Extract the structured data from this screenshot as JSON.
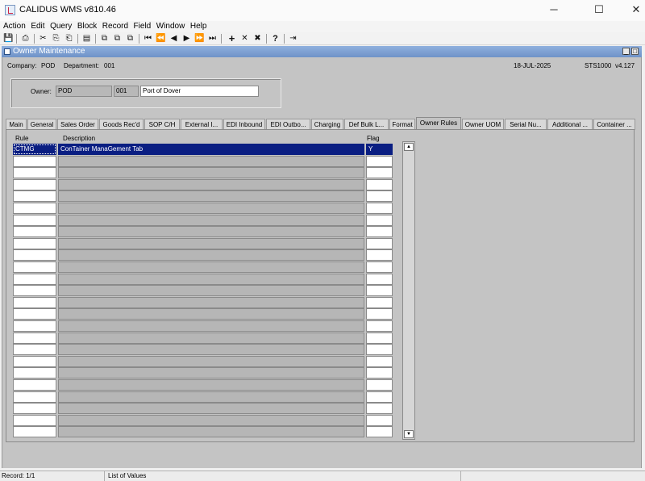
{
  "window": {
    "title": "CALIDUS WMS v810.46",
    "min_glyph": "─",
    "max_glyph": "☐",
    "close_glyph": "✕"
  },
  "menu": [
    "Action",
    "Edit",
    "Query",
    "Block",
    "Record",
    "Field",
    "Window",
    "Help"
  ],
  "toolbar_icons": {
    "save": "save-icon",
    "print": "print-icon",
    "cut": "cut-icon",
    "copy": "copy-icon",
    "paste": "paste-icon",
    "clear": "clear-icon",
    "first": "first-record-icon",
    "prev_block": "previous-block-icon",
    "prev": "previous-record-icon",
    "next": "next-record-icon",
    "next_block": "next-block-icon",
    "last": "last-record-icon",
    "insert": "insert-record-icon",
    "delete": "delete-record-icon",
    "help": "help-icon",
    "exit": "exit-icon"
  },
  "form": {
    "title": "Owner Maintenance"
  },
  "info": {
    "company": "Company:",
    "company_value": "POD",
    "department": "Department:",
    "department_value": "001",
    "date": "18-JUL-2025",
    "module": "STS1000",
    "version": "v4.127"
  },
  "owner": {
    "label": "Owner:",
    "code": "POD",
    "dept": "001",
    "name": "Port of Dover"
  },
  "tabs": [
    "Main",
    "General",
    "Sales Order",
    "Goods Rec'd",
    "SOP C/H",
    "External I...",
    "EDI Inbound",
    "EDI Outbo...",
    "Charging",
    "Def Bulk L...",
    "Format",
    "Owner Rules",
    "Owner UOM",
    "Serial Nu...",
    "Additional ...",
    "Container ..."
  ],
  "active_tab": "Owner Rules",
  "grid": {
    "headers": {
      "rule": "Rule",
      "description": "Description",
      "flag": "Flag"
    },
    "rows": [
      {
        "rule": "CTMG",
        "description": "ConTainer ManaGement Tab",
        "flag": "Y"
      }
    ],
    "visible_rows": 25
  },
  "status": {
    "record": "Record: 1/1",
    "lov": "List of Values"
  },
  "colors": {
    "selection": "#0a1e82",
    "form_title": "#7fa2d4",
    "canvas": "#c4c4c4"
  }
}
